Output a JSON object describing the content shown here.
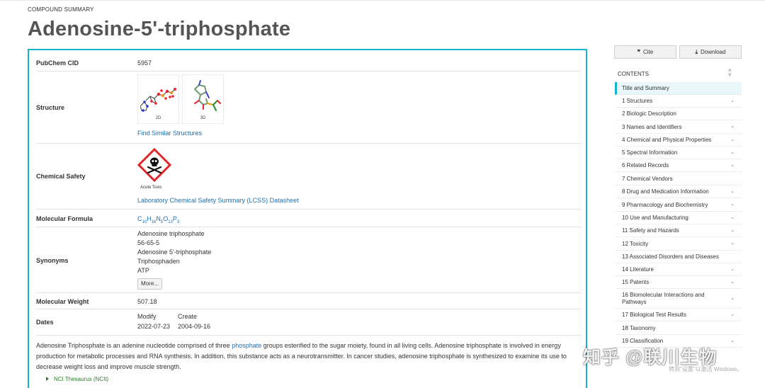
{
  "header": {
    "kicker": "COMPOUND SUMMARY",
    "title": "Adenosine-5'-triphosphate"
  },
  "summary": {
    "cid": {
      "label": "PubChem CID",
      "value": "5957"
    },
    "structure": {
      "label": "Structure",
      "thumb_2d": "2D",
      "thumb_3d": "3D",
      "link": "Find Similar Structures"
    },
    "safety": {
      "label": "Chemical Safety",
      "pictogram_icon": "skull-crossbones-icon",
      "pictogram_caption": "Acute Toxic",
      "link": "Laboratory Chemical Safety Summary (LCSS) Datasheet"
    },
    "formula": {
      "label": "Molecular Formula",
      "parts": [
        {
          "text": "C",
          "sub": "10"
        },
        {
          "text": "H",
          "sub": "16"
        },
        {
          "text": "N",
          "sub": "5"
        },
        {
          "text": "O",
          "sub": "13"
        },
        {
          "text": "P",
          "sub": "3"
        }
      ]
    },
    "synonyms": {
      "label": "Synonyms",
      "items": [
        "Adenosine triphosphate",
        "56-65-5",
        "Adenosine 5'-triphosphate",
        "Triphosphaden",
        "ATP"
      ],
      "more_label": "More..."
    },
    "weight": {
      "label": "Molecular Weight",
      "value": "507.18"
    },
    "dates": {
      "label": "Dates",
      "modify_label": "Modify",
      "modify_value": "2022-07-23",
      "create_label": "Create",
      "create_value": "2004-09-16"
    },
    "description": {
      "before": "Adenosine Triphosphate is an adenine nucleotide comprised of three ",
      "link": "phosphate",
      "after": " groups esterified to the sugar moiety, found in all living cells. Adenosine triphosphate is involved in energy production for metabolic processes and RNA synthesis. In addition, this substance acts as a neurotransmitter. In cancer studies, adenosine triphosphate is synthesized to examine its use to decrease weight loss and improve muscle strength."
    },
    "source": "NCI Thesaurus (NCIt)"
  },
  "actions": {
    "cite_label": "Cite",
    "cite_icon": "quote-icon",
    "download_label": "Download",
    "download_icon": "download-icon"
  },
  "contents": {
    "heading": "CONTENTS",
    "items": [
      {
        "label": "Title and Summary",
        "expandable": false,
        "active": true
      },
      {
        "label": "1 Structures",
        "expandable": true
      },
      {
        "label": "2 Biologic Description",
        "expandable": false
      },
      {
        "label": "3 Names and Identifiers",
        "expandable": true
      },
      {
        "label": "4 Chemical and Physical Properties",
        "expandable": true
      },
      {
        "label": "5 Spectral Information",
        "expandable": true
      },
      {
        "label": "6 Related Records",
        "expandable": true
      },
      {
        "label": "7 Chemical Vendors",
        "expandable": false
      },
      {
        "label": "8 Drug and Medication Information",
        "expandable": true
      },
      {
        "label": "9 Pharmacology and Biochemistry",
        "expandable": true
      },
      {
        "label": "10 Use and Manufacturing",
        "expandable": true
      },
      {
        "label": "11 Safety and Hazards",
        "expandable": true
      },
      {
        "label": "12 Toxicity",
        "expandable": true
      },
      {
        "label": "13 Associated Disorders and Diseases",
        "expandable": false
      },
      {
        "label": "14 Literature",
        "expandable": true
      },
      {
        "label": "15 Patents",
        "expandable": true
      },
      {
        "label": "16 Biomolecular Interactions and Pathways",
        "expandable": true
      },
      {
        "label": "17 Biological Test Results",
        "expandable": true
      },
      {
        "label": "18 Taxonomy",
        "expandable": false
      },
      {
        "label": "19 Classification",
        "expandable": true
      }
    ]
  },
  "overlay": {
    "watermark": "知乎 @联川生物",
    "windows_notice": "转到\"设置\"以激活 Windows。"
  },
  "colors": {
    "accent": "#16b3d1",
    "link": "#1f6fb0",
    "title": "#555555",
    "hazard_red": "#e0262a",
    "source_green": "#2f7a2f"
  }
}
